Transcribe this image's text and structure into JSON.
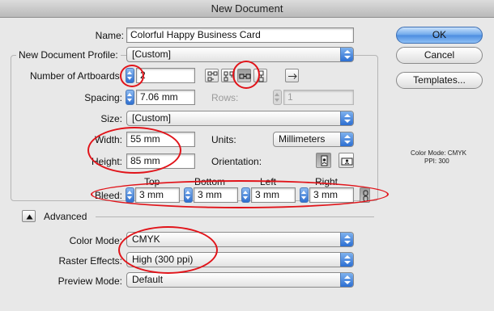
{
  "window": {
    "title": "New Document"
  },
  "form": {
    "name_label": "Name:",
    "name_value": "Colorful Happy Business Card",
    "profile_label": "New Document Profile:",
    "profile_value": "[Custom]",
    "artboards_label": "Number of Artboards:",
    "artboards_value": "2",
    "spacing_label": "Spacing:",
    "spacing_value": "7.06 mm",
    "rows_label": "Rows:",
    "rows_value": "1",
    "size_label": "Size:",
    "size_value": "[Custom]",
    "width_label": "Width:",
    "width_value": "55 mm",
    "units_label": "Units:",
    "units_value": "Millimeters",
    "height_label": "Height:",
    "height_value": "85 mm",
    "orientation_label": "Orientation:",
    "bleed": {
      "label": "Bleed:",
      "top_label": "Top",
      "bottom_label": "Bottom",
      "left_label": "Left",
      "right_label": "Right",
      "top": "3 mm",
      "bottom": "3 mm",
      "left": "3 mm",
      "right": "3 mm"
    },
    "advanced_label": "Advanced",
    "color_mode_label": "Color Mode:",
    "color_mode_value": "CMYK",
    "raster_label": "Raster Effects:",
    "raster_value": "High (300 ppi)",
    "preview_label": "Preview Mode:",
    "preview_value": "Default"
  },
  "buttons": {
    "ok": "OK",
    "cancel": "Cancel",
    "templates": "Templates..."
  },
  "info": {
    "line1": "Color Mode: CMYK",
    "line2": "PPI: 300"
  },
  "colors": {
    "accent": "#2d6fd2",
    "annotation": "#e1141a"
  }
}
